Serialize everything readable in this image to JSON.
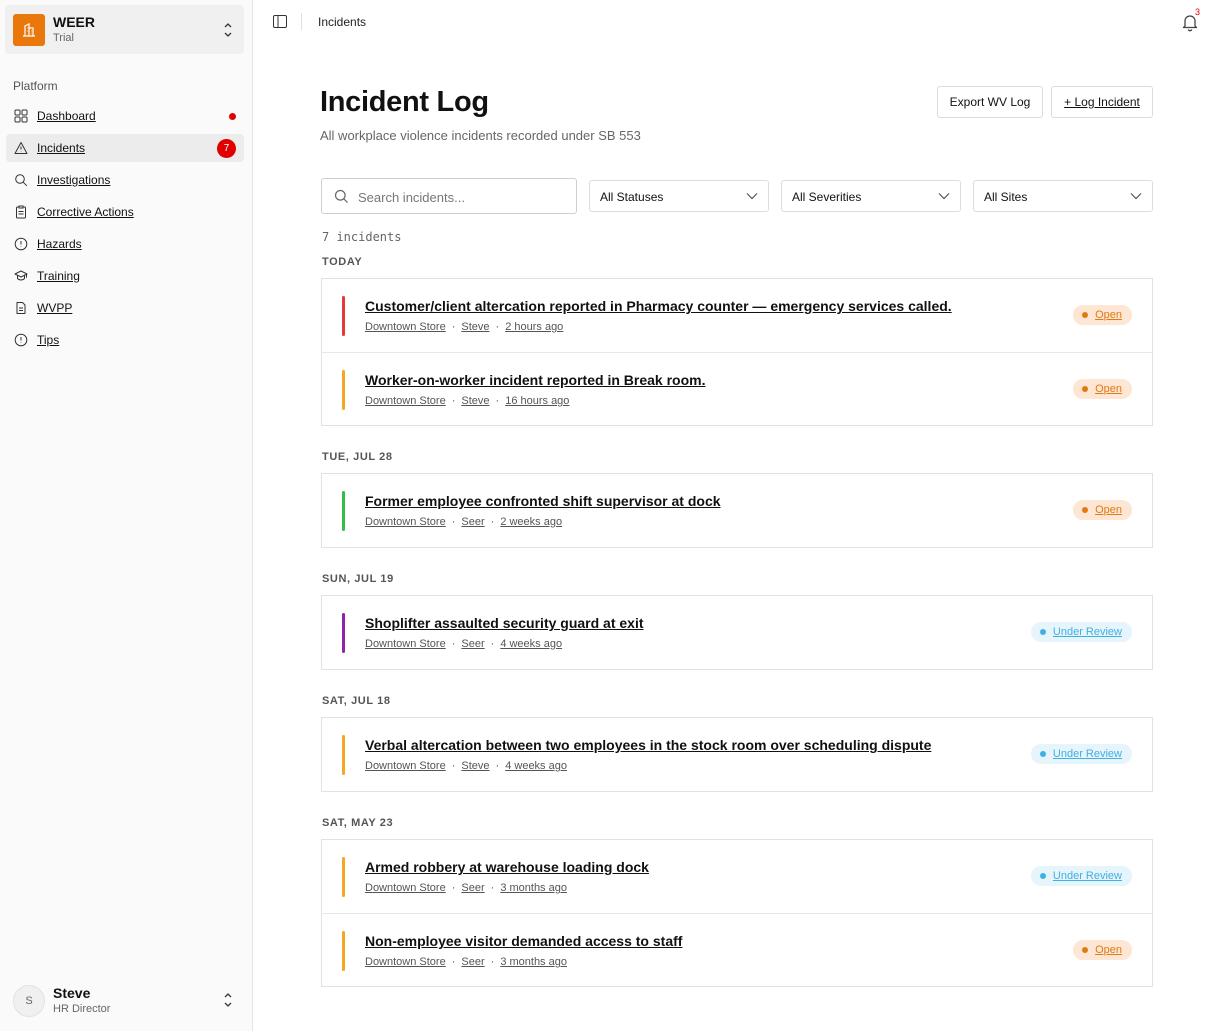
{
  "org": {
    "name": "WEER",
    "plan": "Trial"
  },
  "sidebar": {
    "section": "Platform",
    "items": [
      {
        "label": "Dashboard",
        "icon": "grid-icon"
      },
      {
        "label": "Incidents",
        "icon": "warning-icon",
        "badge": "7"
      },
      {
        "label": "Investigations",
        "icon": "search-icon"
      },
      {
        "label": "Corrective Actions",
        "icon": "clipboard-icon"
      },
      {
        "label": "Hazards",
        "icon": "alert-circle-icon"
      },
      {
        "label": "Training",
        "icon": "graduation-cap-icon"
      },
      {
        "label": "WVPP",
        "icon": "document-icon"
      },
      {
        "label": "Tips",
        "icon": "alert-circle-icon"
      }
    ]
  },
  "user": {
    "initial": "S",
    "name": "Steve",
    "role": "HR Director"
  },
  "header": {
    "breadcrumb": "Incidents",
    "notifications": "3"
  },
  "page": {
    "title": "Incident Log",
    "subtitle": "All workplace violence incidents recorded under SB 553",
    "export_label": "Export WV Log",
    "log_label": "+ Log Incident"
  },
  "filters": {
    "search_placeholder": "Search incidents...",
    "status": "All Statuses",
    "severity": "All Severities",
    "site": "All Sites"
  },
  "count": "7 incidents",
  "colors": {
    "accent": "#e9770b",
    "open": "#e27a12",
    "review": "#40b0e3",
    "red": "#e53935",
    "orange": "#f5a623",
    "green": "#2fbf4a",
    "purple": "#8e24aa"
  },
  "groups": [
    {
      "label": "TODAY",
      "incidents": [
        {
          "title": "Customer/client altercation reported in Pharmacy counter — emergency services called.",
          "site": "Downtown Store",
          "reporter": "Steve",
          "time": "2 hours ago",
          "status": "Open",
          "severity_color": "#e53935"
        },
        {
          "title": "Worker-on-worker incident reported in Break room.",
          "site": "Downtown Store",
          "reporter": "Steve",
          "time": "16 hours ago",
          "status": "Open",
          "severity_color": "#f5a623"
        }
      ]
    },
    {
      "label": "TUE, JUL 28",
      "incidents": [
        {
          "title": "Former employee confronted shift supervisor at dock",
          "site": "Downtown Store",
          "reporter": "Seer",
          "time": "2 weeks ago",
          "status": "Open",
          "severity_color": "#2fbf4a"
        }
      ]
    },
    {
      "label": "SUN, JUL 19",
      "incidents": [
        {
          "title": "Shoplifter assaulted security guard at exit",
          "site": "Downtown Store",
          "reporter": "Seer",
          "time": "4 weeks ago",
          "status": "Under Review",
          "severity_color": "#8e24aa"
        }
      ]
    },
    {
      "label": "SAT, JUL 18",
      "incidents": [
        {
          "title": "Verbal altercation between two employees in the stock room over scheduling dispute",
          "site": "Downtown Store",
          "reporter": "Steve",
          "time": "4 weeks ago",
          "status": "Under Review",
          "severity_color": "#f5a623"
        }
      ]
    },
    {
      "label": "SAT, MAY 23",
      "incidents": [
        {
          "title": "Armed robbery at warehouse loading dock",
          "site": "Downtown Store",
          "reporter": "Seer",
          "time": "3 months ago",
          "status": "Under Review",
          "severity_color": "#f5a623"
        },
        {
          "title": "Non-employee visitor demanded access to staff",
          "site": "Downtown Store",
          "reporter": "Seer",
          "time": "3 months ago",
          "status": "Open",
          "severity_color": "#f5a623"
        }
      ]
    }
  ]
}
